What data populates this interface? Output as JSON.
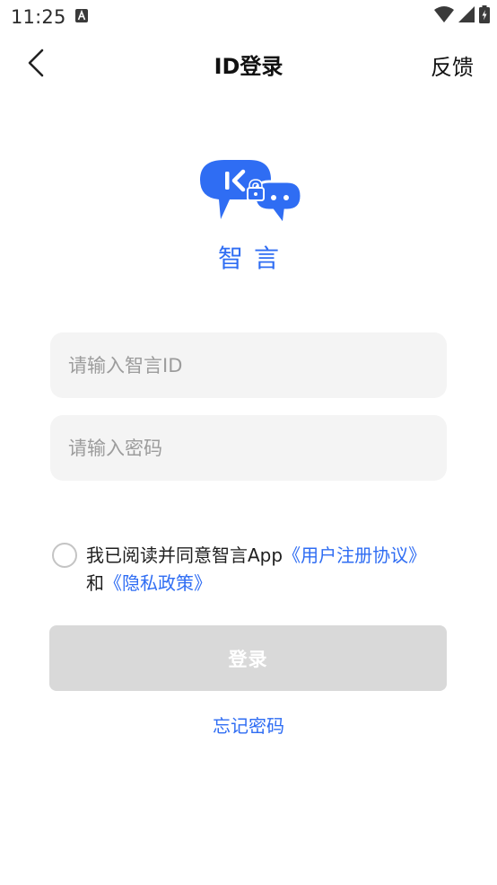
{
  "status_bar": {
    "time": "11:25",
    "icons": [
      "notification-a-icon",
      "wifi-icon",
      "cellular-signal-icon",
      "battery-charging-icon"
    ]
  },
  "nav": {
    "back_icon": "chevron-left-icon",
    "title": "ID登录",
    "feedback_label": "反馈"
  },
  "logo": {
    "icon": "chat-bubbles-lock-icon",
    "name": "智言"
  },
  "form": {
    "id_value": "",
    "id_placeholder": "请输入智言ID",
    "password_value": "",
    "password_placeholder": "请输入密码"
  },
  "agreement": {
    "checked": false,
    "prefix": "我已阅读并同意智言App",
    "user_agreement": "《用户注册协议》",
    "connector": "和",
    "privacy_policy": "《隐私政策》"
  },
  "login_label": "登录",
  "forgot_password": "忘记密码",
  "colors": {
    "accent": "#2f6df3",
    "input_bg": "#f4f4f4",
    "button_disabled_bg": "#d9d9d9",
    "placeholder": "#9c9c9c"
  }
}
